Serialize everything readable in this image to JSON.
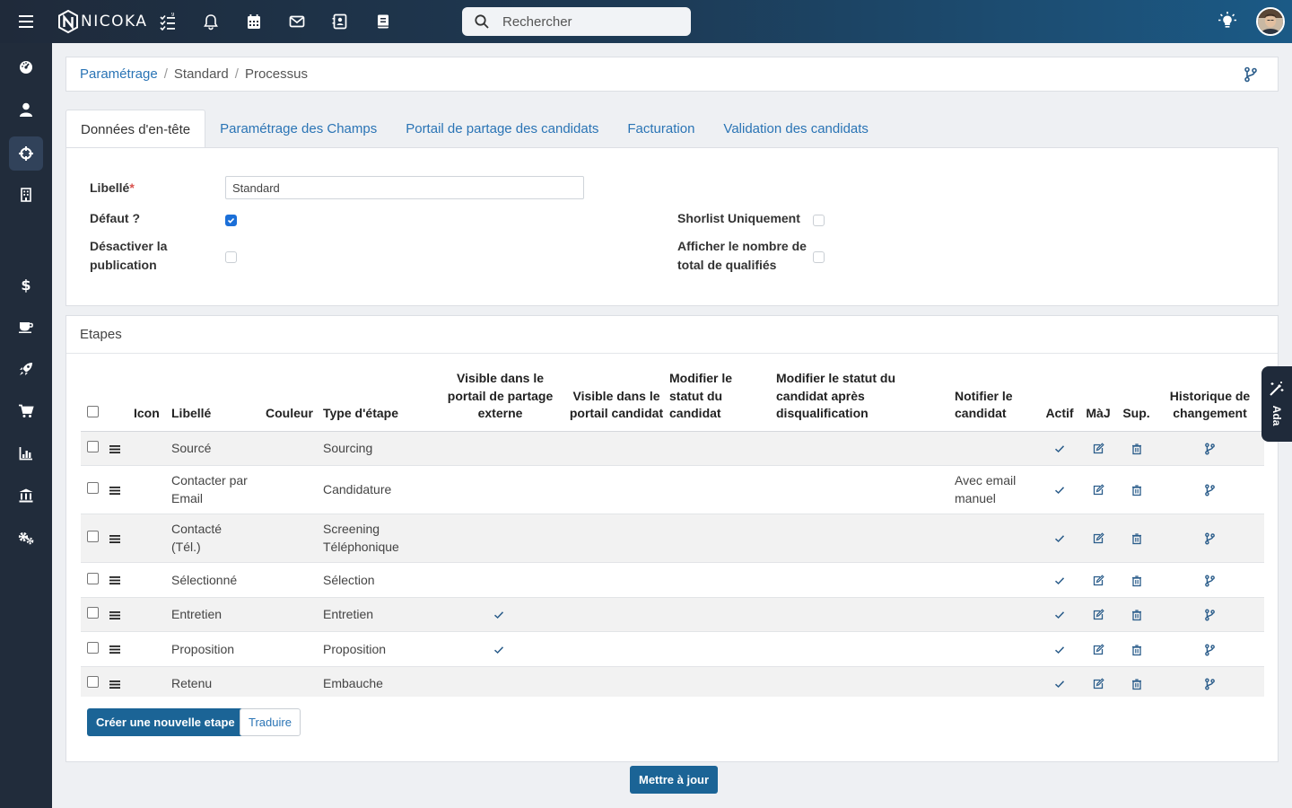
{
  "app": {
    "logo_text": "NICOKA"
  },
  "search": {
    "placeholder": "Rechercher"
  },
  "breadcrumb": {
    "items": [
      "Paramétrage",
      "Standard",
      "Processus"
    ]
  },
  "tabs": [
    {
      "label": "Données d'en-tête",
      "active": true
    },
    {
      "label": "Paramétrage des Champs"
    },
    {
      "label": "Portail de partage des candidats"
    },
    {
      "label": "Facturation"
    },
    {
      "label": "Validation des candidats"
    }
  ],
  "form": {
    "libelle_label": "Libellé",
    "libelle_required": "*",
    "libelle_value": "Standard",
    "defaut_label": "Défaut ?",
    "defaut_checked": true,
    "desactiver_label_1": "Désactiver la",
    "desactiver_label_2": "publication",
    "desactiver_checked": false,
    "shortlist_label": "Shorlist Uniquement",
    "shortlist_checked": false,
    "afficher_label_1": "Afficher le nombre de",
    "afficher_label_2": "total de qualifiés",
    "afficher_checked": false
  },
  "etapes": {
    "title": "Etapes",
    "columns": {
      "icon": "Icon",
      "libelle": "Libellé",
      "couleur": "Couleur",
      "type": "Type d'étape",
      "visible_ext_1": "Visible dans le",
      "visible_ext_2": "portail de partage",
      "visible_ext_3": "externe",
      "visible_cand_1": "Visible dans le",
      "visible_cand_2": "portail candidat",
      "modif_statut_1": "Modifier le",
      "modif_statut_2": "statut du",
      "modif_statut_3": "candidat",
      "modif_disq_1": "Modifier le statut du",
      "modif_disq_2": "candidat après",
      "modif_disq_3": "disqualification",
      "notifier_1": "Notifier le",
      "notifier_2": "candidat",
      "actif": "Actif",
      "maj": "MàJ",
      "sup": "Sup.",
      "historique_1": "Historique de",
      "historique_2": "changement"
    },
    "rows": [
      {
        "libelle_1": "Sourcé",
        "libelle_2": "",
        "type_1": "Sourcing",
        "type_2": "",
        "visible_ext": false,
        "notifier_1": "",
        "notifier_2": ""
      },
      {
        "libelle_1": "Contacter par",
        "libelle_2": "Email",
        "type_1": "Candidature",
        "type_2": "",
        "visible_ext": false,
        "notifier_1": "Avec email",
        "notifier_2": "manuel"
      },
      {
        "libelle_1": "Contacté",
        "libelle_2": "(Tél.)",
        "type_1": "Screening",
        "type_2": "Téléphonique",
        "visible_ext": false,
        "notifier_1": "",
        "notifier_2": ""
      },
      {
        "libelle_1": "Sélectionné",
        "libelle_2": "",
        "type_1": "Sélection",
        "type_2": "",
        "visible_ext": false,
        "notifier_1": "",
        "notifier_2": ""
      },
      {
        "libelle_1": "Entretien",
        "libelle_2": "",
        "type_1": "Entretien",
        "type_2": "",
        "visible_ext": true,
        "notifier_1": "",
        "notifier_2": ""
      },
      {
        "libelle_1": "Proposition",
        "libelle_2": "",
        "type_1": "Proposition",
        "type_2": "",
        "visible_ext": true,
        "notifier_1": "",
        "notifier_2": ""
      },
      {
        "libelle_1": "Retenu",
        "libelle_2": "",
        "type_1": "Embauche",
        "type_2": "",
        "visible_ext": false,
        "notifier_1": "",
        "notifier_2": ""
      }
    ],
    "create_button": "Créer une nouvelle etape",
    "translate_button": "Traduire"
  },
  "update_button": "Mettre à jour",
  "ada": {
    "label": "Ada"
  },
  "colors": {
    "topbar_start": "#1f2a3a",
    "topbar_end": "#1b5a86",
    "sidebar": "#212c3b",
    "primary_button": "#1b6496",
    "link": "#2a74b5",
    "check_blue": "#1b6fd8"
  }
}
